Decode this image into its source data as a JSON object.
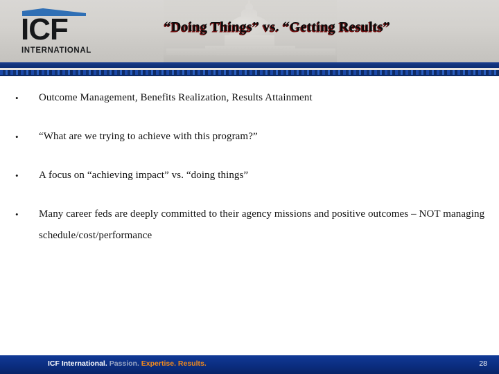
{
  "header": {
    "logo": {
      "mark": "ICF",
      "sub": "INTERNATIONAL",
      "swoosh_color": "#2f6fb5"
    },
    "title": "“Doing Things” vs. “Getting Results”",
    "background_image": "us-capitol-dome",
    "background_color": "#d5d3cf",
    "accent_color": "#0f3180"
  },
  "body": {
    "bullets": [
      "Outcome Management, Benefits Realization, Results Attainment",
      "“What are we trying to achieve with this program?”",
      "A focus on “achieving impact” vs. “doing things”",
      "Many career feds are deeply committed to their agency missions and positive outcomes – NOT managing schedule/cost/performance"
    ]
  },
  "footer": {
    "brand": "ICF International.",
    "passion": "Passion.",
    "expertise": "Expertise.",
    "results": "Results.",
    "page_number": "28",
    "background_color": "#0b2d80",
    "accent_color": "#f08a1e"
  }
}
